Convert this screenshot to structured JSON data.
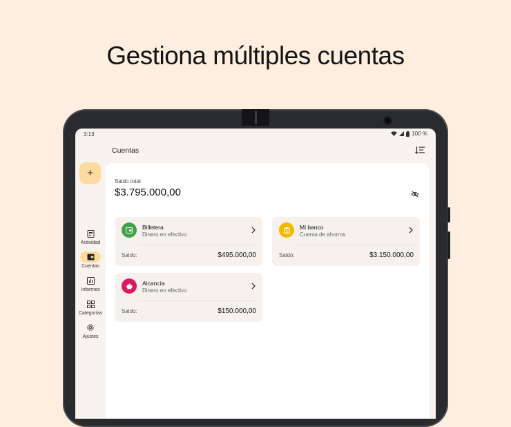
{
  "headline": "Gestiona múltiples cuentas",
  "status": {
    "time": "3:13",
    "battery": "100 %"
  },
  "topbar": {
    "title": "Cuentas"
  },
  "fab_label": "+",
  "nav": [
    {
      "label": "Actividad",
      "icon": "activity-icon",
      "active": false
    },
    {
      "label": "Cuentas",
      "icon": "wallet-icon",
      "active": true
    },
    {
      "label": "Informes",
      "icon": "chart-icon",
      "active": false
    },
    {
      "label": "Categorías",
      "icon": "categories-icon",
      "active": false
    },
    {
      "label": "Ajustes",
      "icon": "settings-icon",
      "active": false
    }
  ],
  "summary": {
    "label": "Saldo total",
    "value": "$3.795.000,00"
  },
  "accounts": [
    {
      "name": "Billetera",
      "type": "Dinero en efectivo",
      "balance_label": "Saldo:",
      "balance": "$495.000,00",
      "color": "#43a04a",
      "icon": "wallet-icon"
    },
    {
      "name": "Mi banco",
      "type": "Cuenta de ahorros",
      "balance_label": "Saldo:",
      "balance": "$3.150.000,00",
      "color": "#f5b800",
      "icon": "bank-icon"
    },
    {
      "name": "Alcancía",
      "type": "Dinero en efectivo",
      "balance_label": "Saldo:",
      "balance": "$150.000,00",
      "color": "#d81b5e",
      "icon": "piggy-bank-icon"
    }
  ]
}
